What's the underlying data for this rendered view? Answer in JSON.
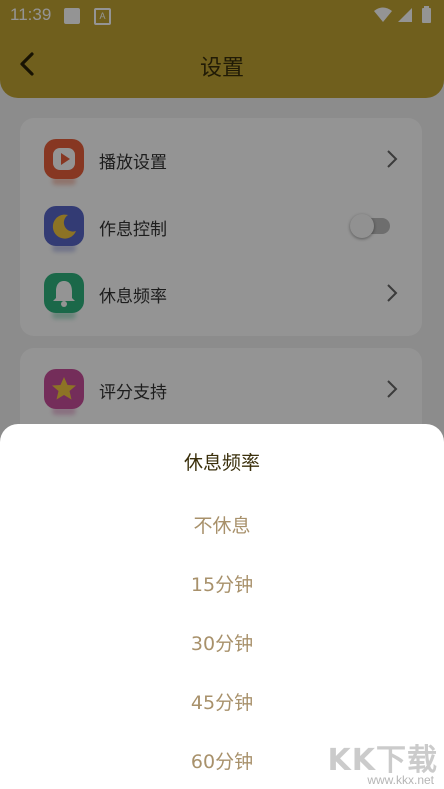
{
  "status_bar": {
    "time": "11:39",
    "a_badge": "A"
  },
  "header": {
    "title": "设置"
  },
  "settings_card_1": {
    "items": [
      {
        "label": "播放设置",
        "control": "chevron"
      },
      {
        "label": "作息控制",
        "control": "toggle",
        "toggle_on": false
      },
      {
        "label": "休息频率",
        "control": "chevron"
      }
    ]
  },
  "settings_card_2": {
    "items": [
      {
        "label": "评分支持",
        "control": "chevron"
      }
    ]
  },
  "sheet": {
    "title": "休息频率",
    "options": [
      "不休息",
      "15分钟",
      "30分钟",
      "45分钟",
      "60分钟"
    ]
  },
  "watermark": {
    "brand": "KK下载",
    "url": "www.kkx.net"
  },
  "colors": {
    "header": "#c2a433",
    "title_text": "#3a2f0b",
    "option_text": "#a8916b",
    "play_icon": "#e8603c",
    "moon_icon": "#5867c9",
    "bell_icon": "#2fb37f",
    "star_icon": "#c94f9c"
  }
}
